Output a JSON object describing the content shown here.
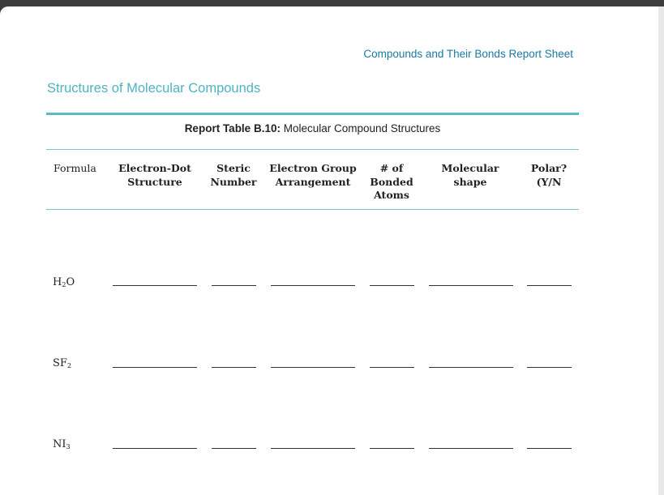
{
  "header": {
    "title": "Compounds and Their Bonds Report Sheet"
  },
  "section": {
    "title": "Structures of Molecular Compounds"
  },
  "table": {
    "caption_bold": "Report Table B.10:",
    "caption_text": " Molecular Compound Structures",
    "columns": [
      {
        "line1": "Formula",
        "line2": "",
        "line3": ""
      },
      {
        "line1": "Electron-Dot",
        "line2": "Structure",
        "line3": ""
      },
      {
        "line1": "Steric",
        "line2": "Number",
        "line3": ""
      },
      {
        "line1": "Electron Group",
        "line2": "Arrangement",
        "line3": ""
      },
      {
        "line1": "# of",
        "line2": "Bonded",
        "line3": "Atoms"
      },
      {
        "line1": "Molecular",
        "line2": "shape",
        "line3": ""
      },
      {
        "line1": "Polar?",
        "line2": "(Y/N",
        "line3": ""
      }
    ],
    "rows": [
      {
        "symbol": "H",
        "sub": "2",
        "tail": "O"
      },
      {
        "symbol": "SF",
        "sub": "2",
        "tail": ""
      },
      {
        "symbol": "NI",
        "sub": "3",
        "tail": ""
      }
    ]
  }
}
